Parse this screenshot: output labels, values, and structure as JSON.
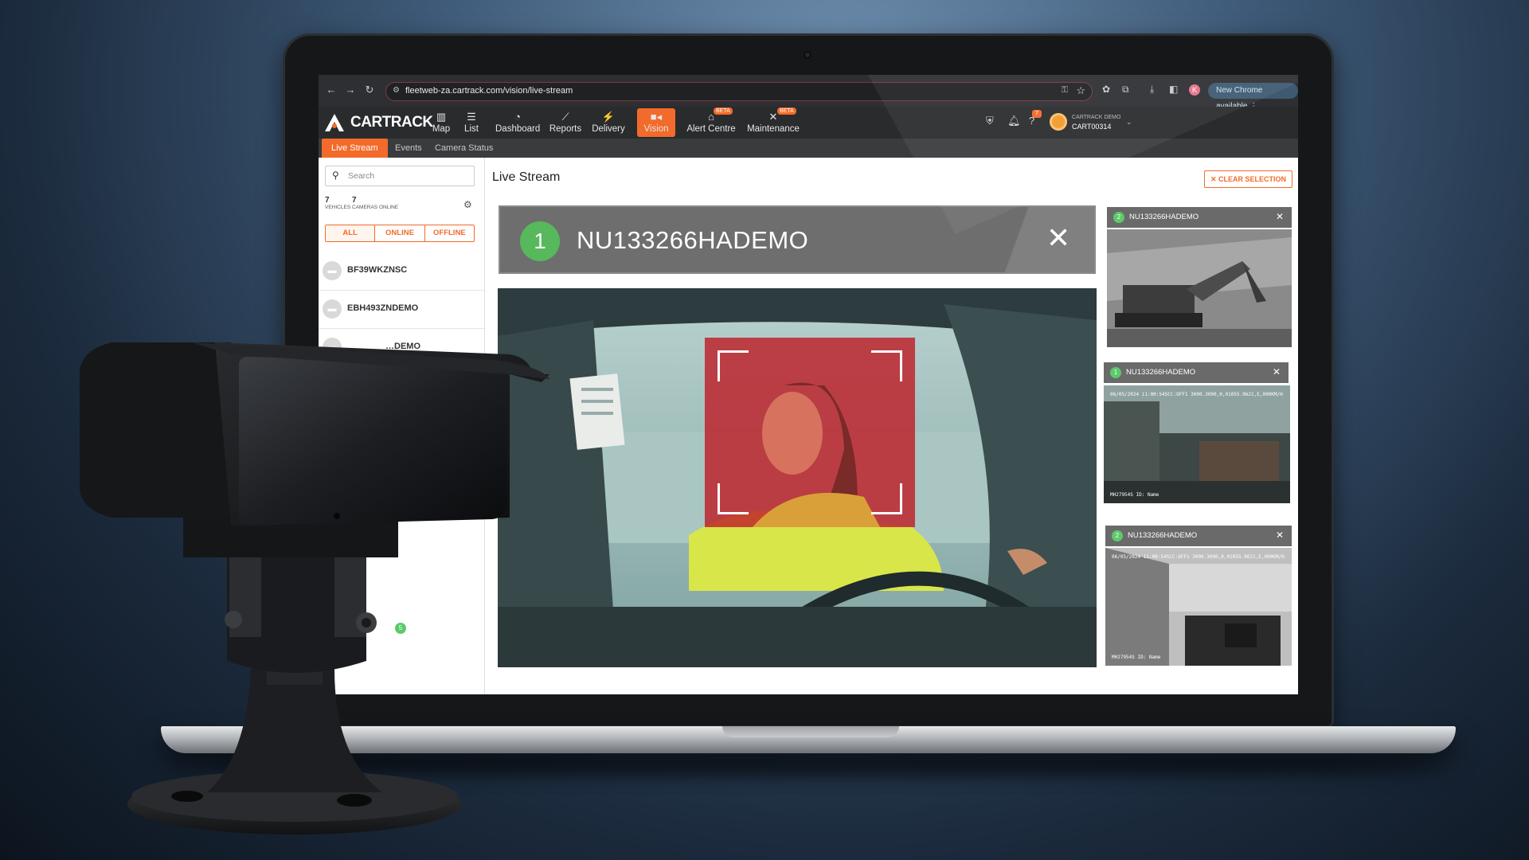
{
  "browser": {
    "url": "fleetweb-za.cartrack.com/vision/live-stream",
    "profile_initial": "K",
    "update_label": "New Chrome available"
  },
  "brand": {
    "name": "CARTRACK"
  },
  "nav": {
    "items": [
      {
        "label": "Map",
        "icon": "map-icon"
      },
      {
        "label": "List",
        "icon": "list-icon"
      },
      {
        "label": "Dashboard",
        "icon": "dashboard-icon"
      },
      {
        "label": "Reports",
        "icon": "reports-icon"
      },
      {
        "label": "Delivery",
        "icon": "delivery-icon"
      },
      {
        "label": "Vision",
        "icon": "video-camera-icon",
        "active": true
      },
      {
        "label": "Alert Centre",
        "icon": "alert-icon",
        "badge": "BETA"
      },
      {
        "label": "Maintenance",
        "icon": "maintenance-icon",
        "badge": "BETA"
      }
    ],
    "notifications_count": "7",
    "account": {
      "company": "CARTRACK DEMO",
      "id": "CART00314"
    }
  },
  "subtabs": [
    {
      "label": "Live Stream",
      "active": true
    },
    {
      "label": "Events"
    },
    {
      "label": "Camera Status"
    }
  ],
  "sidebar": {
    "search_placeholder": "Search",
    "vehicles_count": "7",
    "vehicles_label": "VEHICLES",
    "cameras_count": "7",
    "cameras_label": "CAMERAS ONLINE",
    "filters": [
      "ALL",
      "ONLINE",
      "OFFLINE"
    ],
    "vehicles": [
      {
        "name": "BF39WKZNSC"
      },
      {
        "name": "EBH493ZNDEMO"
      },
      {
        "name": "…DEMO"
      }
    ],
    "status_badge": "5"
  },
  "main": {
    "title": "Live Stream",
    "clear_label": "CLEAR SELECTION",
    "feed": {
      "number": "1",
      "name": "NU133266HADEMO"
    },
    "thumbs": [
      {
        "number": "2",
        "name": "NU133266HADEMO"
      },
      {
        "number": "1",
        "name": "NU133266HADEMO",
        "osd_top": "06/05/2024 11:00:54SCC:OFF1   3000.3090,0,01055.9621,E,000KM/H",
        "osd_bottom": "MH27954S  ID: Name"
      },
      {
        "number": "2",
        "name": "NU133266HADEMO",
        "osd_top": "06/05/2024 11:00:54SCC:OFF1   3000.3090,0,01055.9621,E,000KM/H",
        "osd_bottom": "MH27954S  ID: Name"
      }
    ]
  }
}
